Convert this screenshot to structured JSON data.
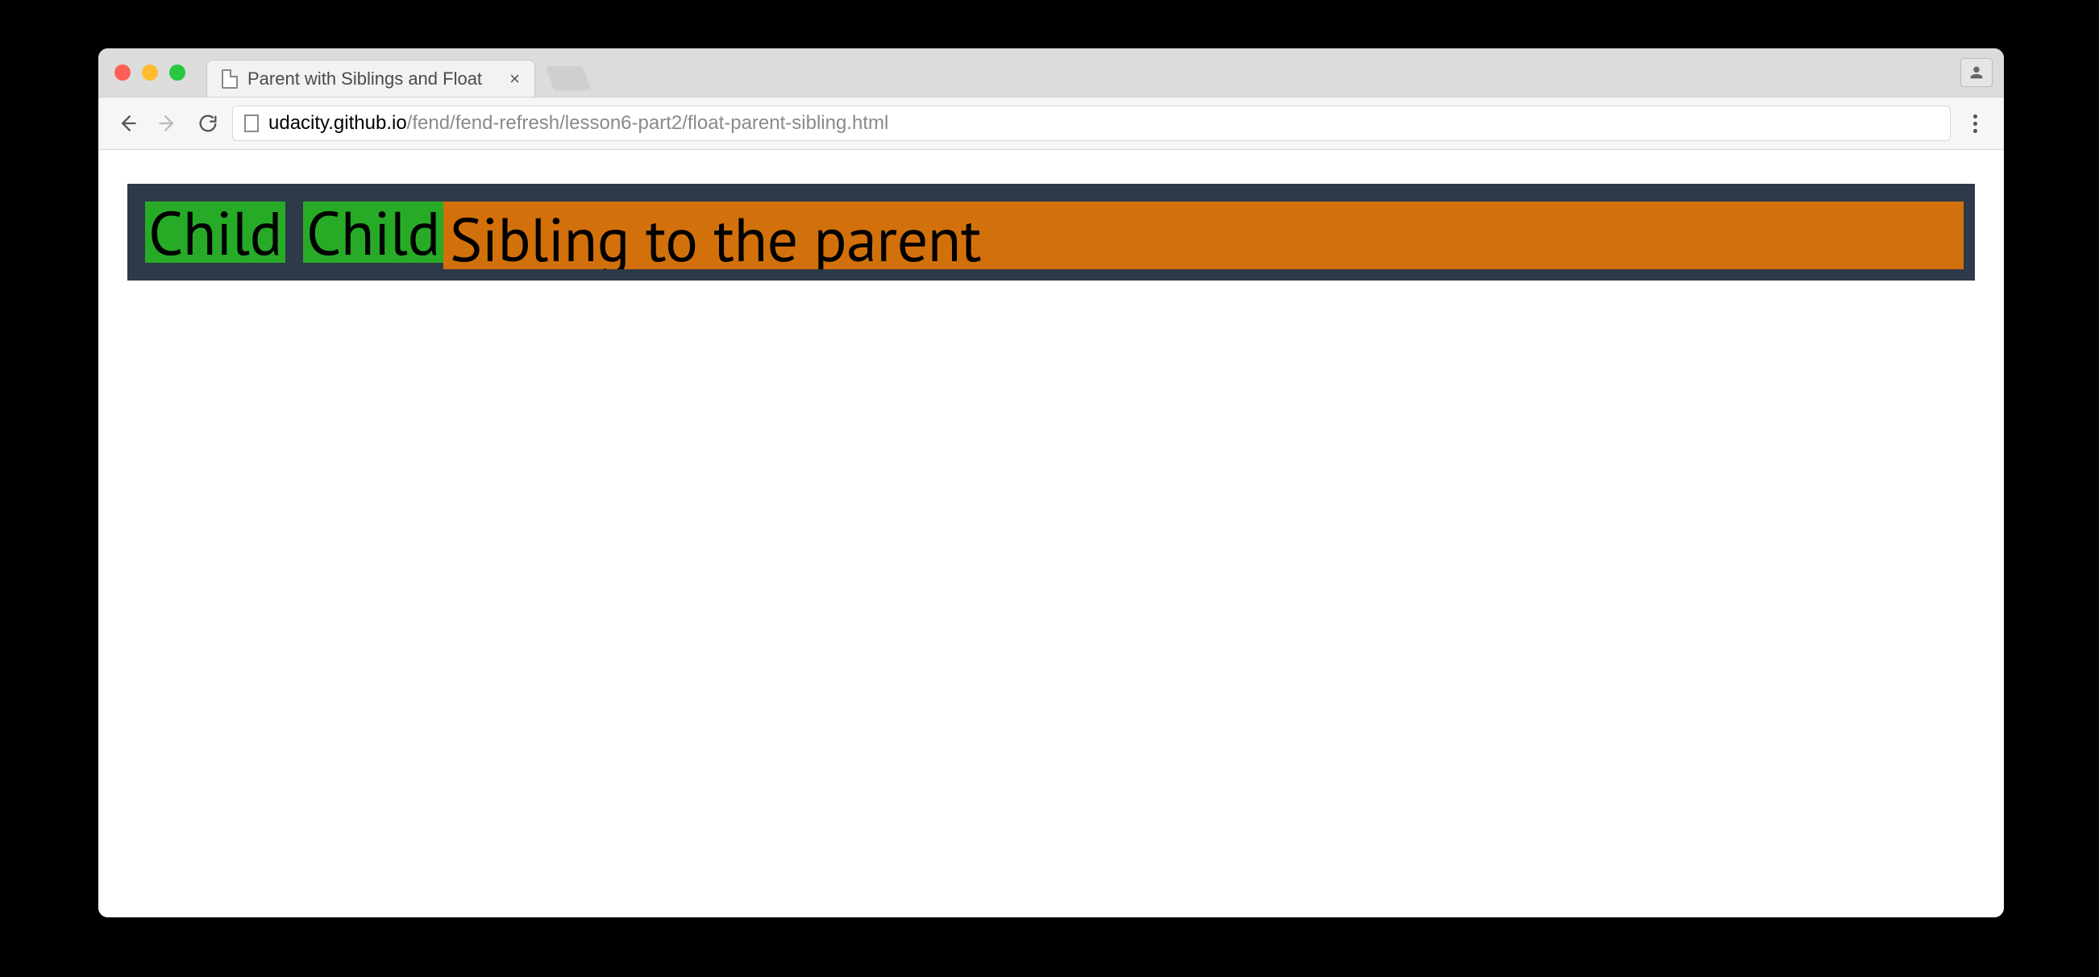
{
  "browser": {
    "tab_title": "Parent with Siblings and Float",
    "url_host": "udacity.github.io",
    "url_path": "/fend/fend-refresh/lesson6-part2/float-parent-sibling.html"
  },
  "page": {
    "child1": "Child",
    "child2": "Child",
    "sibling": "Sibling to the parent"
  }
}
